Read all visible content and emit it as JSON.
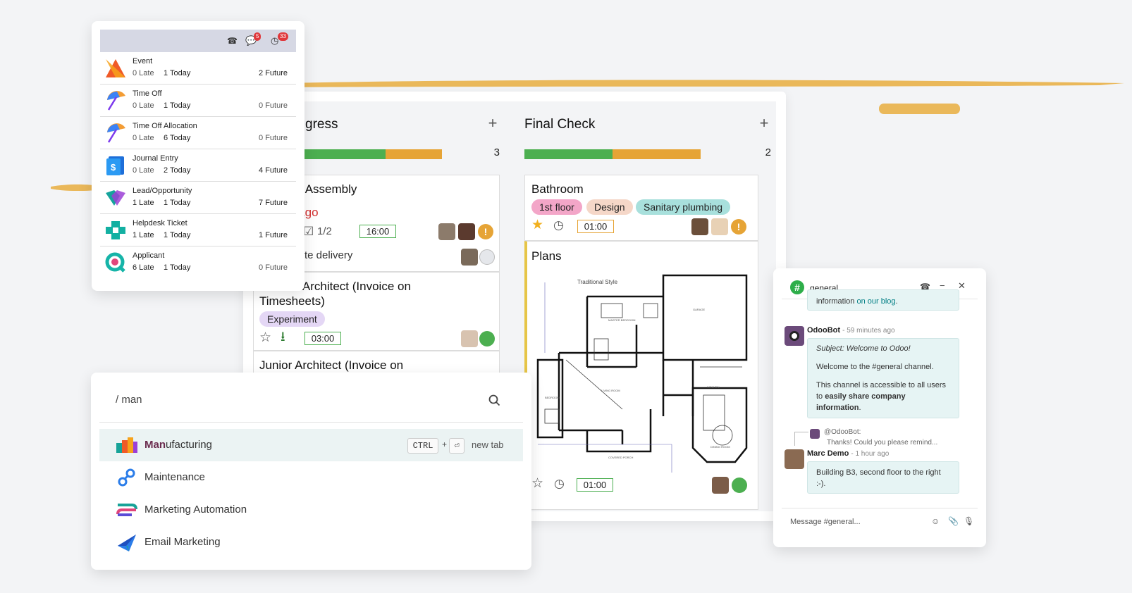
{
  "colors": {
    "green": "#4caf50",
    "orange": "#e6a436",
    "red": "#d32f2f",
    "brand_teal": "#017e84",
    "badge": "#e0373b"
  },
  "activity_panel": {
    "header_icons": [
      "phone-icon",
      "chat-icon",
      "clock-icon"
    ],
    "chat_badge": "5",
    "clock_badge": "33",
    "rows": [
      {
        "name": "Event",
        "late": "0 Late",
        "today": "1 Today",
        "future": "2 Future",
        "icon": "calendar-app-icon"
      },
      {
        "name": "Time Off",
        "late": "0 Late",
        "today": "1 Today",
        "future": "0 Future",
        "icon": "umbrella-icon"
      },
      {
        "name": "Time Off Allocation",
        "late": "0 Late",
        "today": "6 Today",
        "future": "0 Future",
        "icon": "umbrella-icon"
      },
      {
        "name": "Journal Entry",
        "late": "0 Late",
        "today": "2 Today",
        "future": "4 Future",
        "icon": "dollar-icon"
      },
      {
        "name": "Lead/Opportunity",
        "late": "1 Late",
        "today": "1 Today",
        "future": "7 Future",
        "icon": "handshake-icon"
      },
      {
        "name": "Helpdesk Ticket",
        "late": "1 Late",
        "today": "1 Today",
        "future": "1 Future",
        "icon": "lifebuoy-icon"
      },
      {
        "name": "Applicant",
        "late": "6 Late",
        "today": "1 Today",
        "future": "0 Future",
        "icon": "magnifier-icon"
      }
    ]
  },
  "kanban": {
    "columns": [
      {
        "title": "In Progress",
        "title_visible": "gress",
        "count": "3",
        "cards": [
          {
            "title": "Garden Assembly",
            "title_visible": "en Assembly",
            "deadline": "s ago",
            "checklist": "1/2",
            "time": "16:00",
            "note": "te delivery"
          },
          {
            "title_line1": "or Architect (Invoice on",
            "title_line2": "Timesheets)",
            "tag": "Experiment",
            "time": "03:00"
          },
          {
            "title_line1": "Junior Architect (Invoice on"
          }
        ]
      },
      {
        "title": "Final Check",
        "count": "2",
        "cards": [
          {
            "title": "Bathroom",
            "tags": [
              "1st floor",
              "Design",
              "Sanitary plumbing"
            ],
            "time": "01:00"
          },
          {
            "title": "Plans",
            "plan_label": "Traditional Style",
            "time": "01:00"
          }
        ]
      }
    ]
  },
  "command_palette": {
    "query": "/ man",
    "items": [
      {
        "match": "Man",
        "rest": "ufacturing",
        "label": "Manufacturing",
        "icon": "manufacturing-icon"
      },
      {
        "label": "Maintenance",
        "icon": "maintenance-icon"
      },
      {
        "label": "Marketing Automation",
        "icon": "marketing-automation-icon"
      },
      {
        "label": "Email Marketing",
        "icon": "email-marketing-icon"
      }
    ],
    "shortcut_ctrl": "CTRL",
    "shortcut_plus": "+",
    "shortcut_enter": "⏎",
    "shortcut_hint": "new tab"
  },
  "chat": {
    "channel": "general",
    "partial_text": "information ",
    "partial_link": "on our blog",
    "partial_end": ".",
    "messages": [
      {
        "author": "OdooBot",
        "time": "- 59 minutes ago",
        "subject": "Subject: Welcome to Odoo!",
        "line1": "Welcome to the #general channel.",
        "line2a": "This channel is accessible to all users to ",
        "line2b": "easily share company information",
        "line2c": "."
      },
      {
        "reply_to": "@OdooBot:",
        "reply_text": "Thanks! Could you please remind...",
        "author": "Marc Demo",
        "time": "- 1 hour ago",
        "text": "Building B3, second floor to the right :-)."
      }
    ],
    "composer_placeholder": "Message #general..."
  }
}
